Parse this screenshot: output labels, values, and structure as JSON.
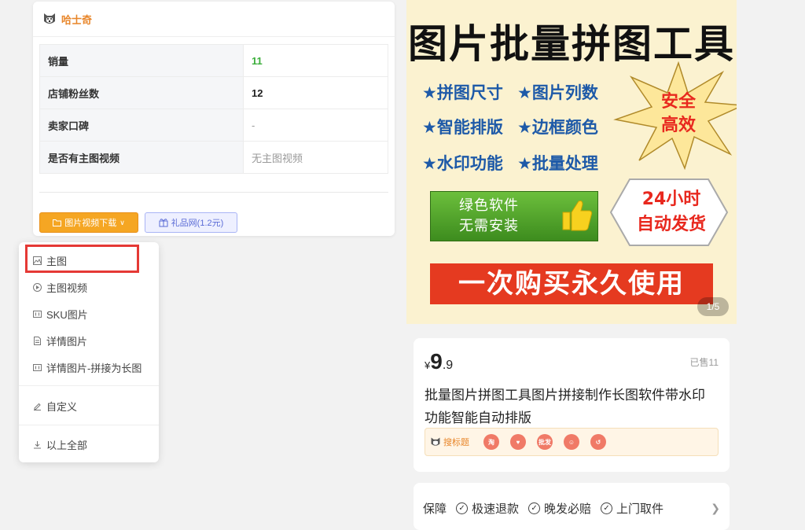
{
  "panel": {
    "title": "哈士奇",
    "rows": [
      {
        "label": "销量",
        "value": "11"
      },
      {
        "label": "店铺粉丝数",
        "value": "12"
      },
      {
        "label": "卖家口碑",
        "value": "-"
      },
      {
        "label": "是否有主图视频",
        "value": "无主图视频"
      }
    ],
    "download_button": "图片视频下载",
    "gift_button": "礼品网(1.2元)"
  },
  "dropdown": {
    "items": [
      "主图",
      "主图视频",
      "SKU图片",
      "详情图片",
      "详情图片-拼接为长图"
    ],
    "custom": "自定义",
    "all": "以上全部"
  },
  "product_image": {
    "title": "图片批量拼图工具",
    "features": [
      "★拼图尺寸",
      "★图片列数",
      "★智能排版",
      "★边框颜色",
      "★水印功能",
      "★批量处理"
    ],
    "burst_line1": "安全",
    "burst_line2": "高效",
    "green_line1": "绿色软件",
    "green_line2": "无需安装",
    "hex_line1": "24小时",
    "hex_line2": "自动发货",
    "banner": "一次购买永久使用",
    "pager": "1/5"
  },
  "product": {
    "currency": "¥",
    "price_int": "9",
    "price_dec": ".9",
    "sold": "已售11",
    "title": "批量图片拼图工具图片拼接制作长图软件带水印功能智能自动排版",
    "tool_label": "搜标题",
    "tools": [
      "淘",
      "",
      "批发",
      "",
      ""
    ]
  },
  "guarantee": {
    "label": "保障",
    "items": [
      "极速退款",
      "晚发必赔",
      "上门取件"
    ]
  }
}
